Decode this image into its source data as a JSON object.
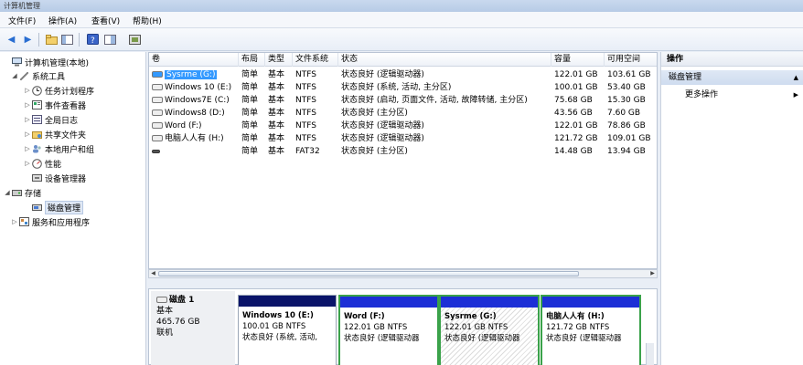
{
  "window": {
    "title": "计算机管理"
  },
  "menu": [
    {
      "label": "文件(F)"
    },
    {
      "label": "操作(A)"
    },
    {
      "label": "查看(V)"
    },
    {
      "label": "帮助(H)"
    }
  ],
  "tree": {
    "items": [
      {
        "label": "计算机管理(本地)",
        "icon": "computer-icon",
        "expander": ""
      },
      {
        "label": "系统工具",
        "icon": "tools-icon",
        "expander": "◢"
      },
      {
        "label": "任务计划程序",
        "icon": "clock-icon",
        "expander": "▷"
      },
      {
        "label": "事件查看器",
        "icon": "event-log-icon",
        "expander": "▷"
      },
      {
        "label": "全局日志",
        "icon": "log-icon",
        "expander": "▷"
      },
      {
        "label": "共享文件夹",
        "icon": "shared-folder-icon",
        "expander": "▷"
      },
      {
        "label": "本地用户和组",
        "icon": "users-icon",
        "expander": "▷"
      },
      {
        "label": "性能",
        "icon": "performance-icon",
        "expander": "▷"
      },
      {
        "label": "设备管理器",
        "icon": "device-manager-icon",
        "expander": ""
      },
      {
        "label": "存储",
        "icon": "storage-icon",
        "expander": "◢"
      },
      {
        "label": "磁盘管理",
        "icon": "disk-management-icon",
        "expander": ""
      },
      {
        "label": "服务和应用程序",
        "icon": "services-icon",
        "expander": "▷"
      }
    ]
  },
  "volumes": {
    "columns": [
      "卷",
      "布局",
      "类型",
      "文件系统",
      "状态",
      "容量",
      "可用空间"
    ],
    "rows": [
      {
        "volume": "Sysrme (G:)",
        "layout": "简单",
        "type": "基本",
        "fs": "NTFS",
        "status": "状态良好 (逻辑驱动器)",
        "capacity": "122.01 GB",
        "free": "103.61 GB"
      },
      {
        "volume": "Windows 10 (E:)",
        "layout": "简单",
        "type": "基本",
        "fs": "NTFS",
        "status": "状态良好 (系统, 活动, 主分区)",
        "capacity": "100.01 GB",
        "free": "53.40 GB"
      },
      {
        "volume": "Windows7E (C:)",
        "layout": "简单",
        "type": "基本",
        "fs": "NTFS",
        "status": "状态良好 (启动, 页面文件, 活动, 故障转储, 主分区)",
        "capacity": "75.68 GB",
        "free": "15.30 GB"
      },
      {
        "volume": "Windows8 (D:)",
        "layout": "简单",
        "type": "基本",
        "fs": "NTFS",
        "status": "状态良好 (主分区)",
        "capacity": "43.56 GB",
        "free": "7.60 GB"
      },
      {
        "volume": "Word (F:)",
        "layout": "简单",
        "type": "基本",
        "fs": "NTFS",
        "status": "状态良好 (逻辑驱动器)",
        "capacity": "122.01 GB",
        "free": "78.86 GB"
      },
      {
        "volume": "电脑人人有 (H:)",
        "layout": "简单",
        "type": "基本",
        "fs": "NTFS",
        "status": "状态良好 (逻辑驱动器)",
        "capacity": "121.72 GB",
        "free": "109.01 GB"
      },
      {
        "volume": "",
        "layout": "简单",
        "type": "基本",
        "fs": "FAT32",
        "status": "状态良好 (主分区)",
        "capacity": "14.48 GB",
        "free": "13.94 GB"
      }
    ]
  },
  "disk": {
    "name": "磁盘 1",
    "type": "基本",
    "size": "465.76 GB",
    "state": "联机",
    "partitions": [
      {
        "name": "Windows 10  (E:)",
        "size": "100.01 GB NTFS",
        "status": "状态良好 (系统, 活动,",
        "bar_color": "#0a1469"
      },
      {
        "name": "Word  (F:)",
        "size": "122.01 GB NTFS",
        "status": "状态良好 (逻辑驱动器",
        "bar_color": "#1c2fd6"
      },
      {
        "name": "Sysrme  (G:)",
        "size": "122.01 GB NTFS",
        "status": "状态良好 (逻辑驱动器",
        "bar_color": "#1c2fd6"
      },
      {
        "name": "电脑人人有  (H:)",
        "size": "121.72 GB NTFS",
        "status": "状态良好 (逻辑驱动器",
        "bar_color": "#1c2fd6"
      }
    ]
  },
  "actions": {
    "header": "操作",
    "section": "磁盘管理",
    "item": "更多操作"
  }
}
